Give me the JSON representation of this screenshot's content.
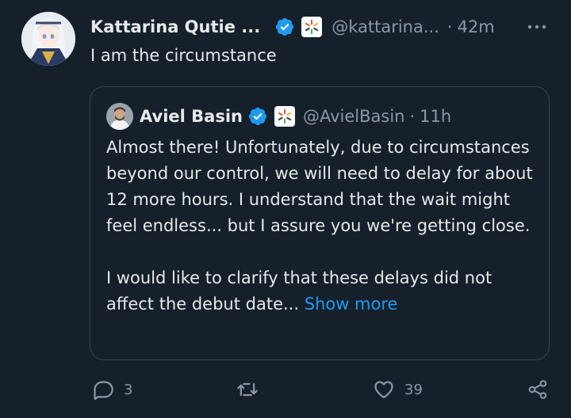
{
  "tweet": {
    "author_name": "Kattarina Qutie ...",
    "handle": "@kattarina...",
    "separator": "·",
    "time": "42m",
    "text": "I am the circumstance"
  },
  "quoted_tweet": {
    "author_name": "Aviel Basin",
    "handle": "@AvielBasin",
    "separator": "·",
    "time": "11h",
    "paragraph_1": "Almost there! Unfortunately, due to circumstances beyond our control, we will need to delay for about 12 more hours. I understand that the wait might feel endless... but I assure you we're getting close.",
    "paragraph_2": "I would like to clarify that these delays did not affect the debut date...",
    "show_more": "Show more"
  },
  "actions": {
    "replies": "3",
    "retweets": "",
    "likes": "39"
  },
  "colors": {
    "background": "#15202b",
    "text": "#e7e9ea",
    "muted": "#8b98a5",
    "accent": "#1d9bf0",
    "border": "#38444d"
  },
  "icons": [
    "verified-badge-icon",
    "affiliate-badge-icon",
    "more-icon",
    "reply-icon",
    "retweet-icon",
    "like-icon",
    "share-icon"
  ]
}
